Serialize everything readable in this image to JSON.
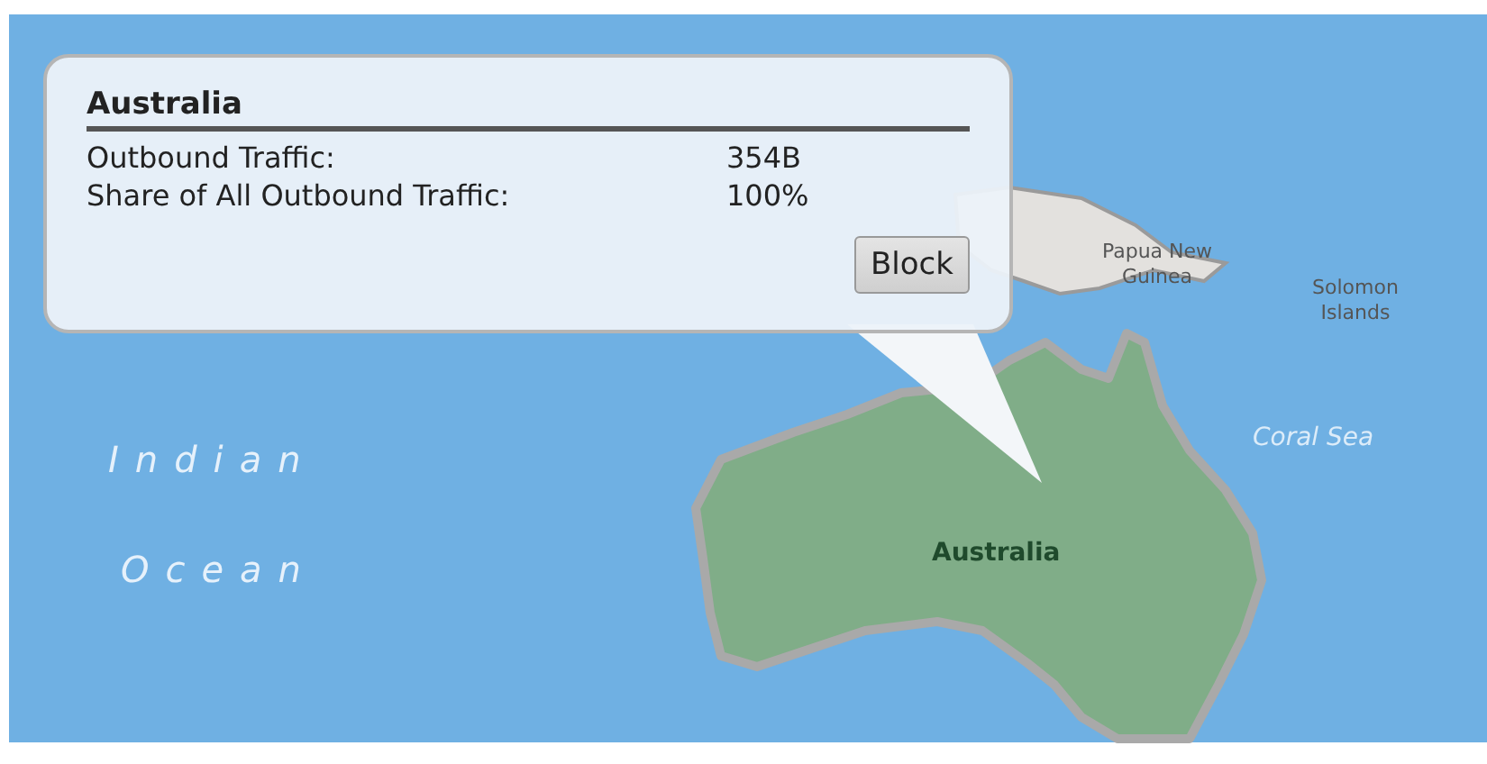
{
  "map": {
    "labels": [
      {
        "text": "Indian",
        "kind": "ocean"
      },
      {
        "text": "Ocean",
        "kind": "ocean"
      },
      {
        "text": "Coral Sea",
        "kind": "sea"
      },
      {
        "text": "Papua New Guinea",
        "kind": "region"
      },
      {
        "text": "Solomon Islands",
        "kind": "region"
      },
      {
        "text": "Australia",
        "kind": "country"
      }
    ]
  },
  "popup": {
    "title": "Australia",
    "rows": [
      {
        "label": "Outbound Traffic:",
        "value": "354B"
      },
      {
        "label": "Share of All Outbound Traffic:",
        "value": "100%"
      }
    ],
    "button": "Block"
  }
}
